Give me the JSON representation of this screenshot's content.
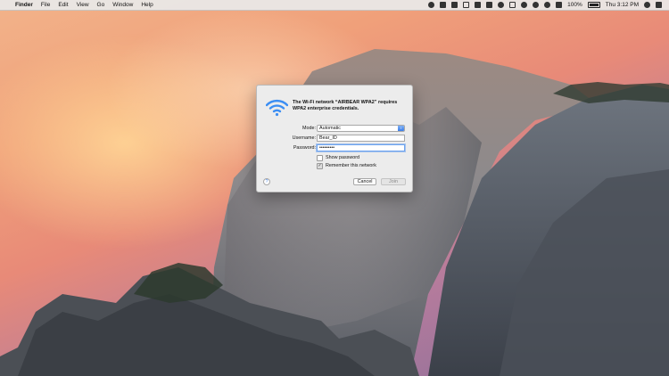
{
  "menubar": {
    "apple_icon": "",
    "items": [
      "Finder",
      "File",
      "Edit",
      "View",
      "Go",
      "Window",
      "Help"
    ],
    "battery_percent": "100%",
    "clock": "Thu 3:12 PM"
  },
  "dialog": {
    "message": "The Wi-Fi network “AIRBEAR WPA2” requires WPA2 enterprise credentials.",
    "mode_label": "Mode:",
    "mode_value": "Automatic",
    "username_label": "Username:",
    "username_value": "Bear_ID",
    "password_label": "Password:",
    "password_value": "•••••••••",
    "show_password_label": "Show password",
    "show_password_checked": false,
    "remember_label": "Remember this network",
    "remember_checked": true,
    "help_label": "?",
    "cancel_label": "Cancel",
    "join_label": "Join"
  },
  "colors": {
    "accent": "#3b7ee8",
    "wifi_icon": "#3c8ef3"
  }
}
